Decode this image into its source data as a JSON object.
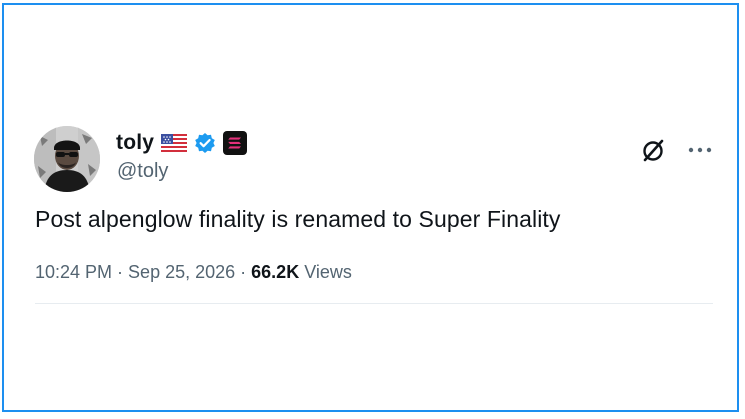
{
  "author": {
    "display_name": "toly",
    "handle": "@toly",
    "flag_icon": "us-flag-icon",
    "verified_icon": "verified-badge-icon",
    "affiliation_icon": "solana-logo-icon"
  },
  "tweet": {
    "text": "Post alpenglow finality is renamed to Super Finality"
  },
  "meta": {
    "time": "10:24 PM",
    "separator": "·",
    "date": "Sep 25, 2026",
    "views_count": "66.2K",
    "views_label": "Views"
  },
  "actions": {
    "grok_icon": "grok-icon",
    "more_icon": "more-options-icon"
  },
  "colors": {
    "frame_border": "#1d8ff0",
    "text_primary": "#0f1419",
    "text_secondary": "#536471",
    "verified_blue": "#1d9bf0",
    "solana_pink": "#e4307a"
  }
}
